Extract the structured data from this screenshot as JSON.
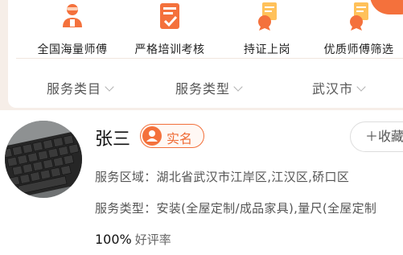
{
  "features": [
    {
      "label": "全国海量师傅",
      "icon": "worker-icon"
    },
    {
      "label": "严格培训考核",
      "icon": "checklist-icon"
    },
    {
      "label": "持证上岗",
      "icon": "certificate-icon"
    },
    {
      "label": "优质师傅筛选",
      "icon": "certificate-icon"
    }
  ],
  "filters": [
    {
      "label": "服务类目"
    },
    {
      "label": "服务类型"
    },
    {
      "label": "武汉市"
    }
  ],
  "profile": {
    "name": "张三",
    "badge": "实名",
    "collect_label": "＋收藏",
    "service_area_label": "服务区域：",
    "service_area_value": "湖北省武汉市江岸区,江汉区,硚口区",
    "service_type_label": "服务类型：",
    "service_type_value": "安装(全屋定制/成品家具),量尺(全屋定制",
    "rating_value": "100%",
    "rating_label": "好评率"
  },
  "colors": {
    "accent": "#f4713c",
    "panel_background": "#f6eee8",
    "text_primary": "#111111",
    "text_secondary": "#555555"
  }
}
